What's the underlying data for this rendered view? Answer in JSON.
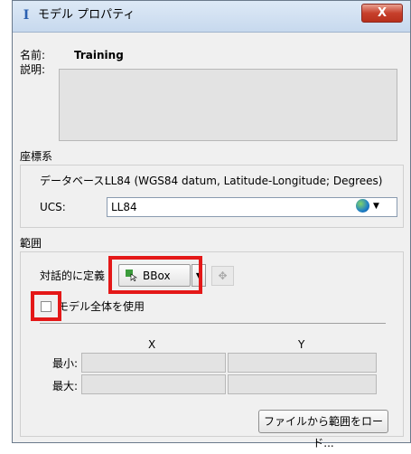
{
  "window": {
    "title": "モデル プロパティ",
    "close_label": "X"
  },
  "model": {
    "name_label": "名前:",
    "name_value": "Training",
    "description_label": "説明:"
  },
  "coordinate_system": {
    "section_label": "座標系",
    "database_label": "データベース:",
    "database_value": "LL84 (WGS84 datum, Latitude-Longitude; Degrees)",
    "ucs_label": "UCS:",
    "ucs_value": "LL84",
    "ucs_icon": "globe-icon"
  },
  "extent": {
    "section_label": "範囲",
    "interactive_label": "対話的に定義",
    "interactive_value": "BBox",
    "use_entire_model_label": "モデル全体を使用",
    "use_entire_model_checked": false,
    "x_header": "X",
    "y_header": "Y",
    "min_label": "最小:",
    "max_label": "最大:",
    "min_x": "",
    "min_y": "",
    "max_x": "",
    "max_y": "",
    "load_button_label": "ファイルから範囲をロード..."
  },
  "highlight_color": "#e41818"
}
